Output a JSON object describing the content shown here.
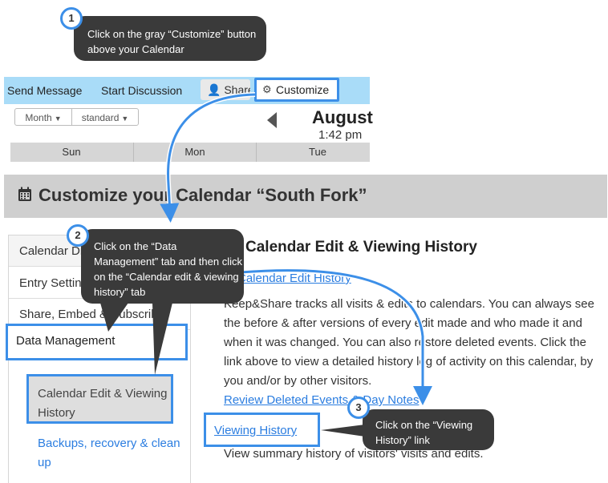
{
  "toolbar": {
    "send_message": "Send Message",
    "start_discussion": "Start Discussion",
    "share": "Share",
    "customize": "Customize"
  },
  "calendar_header": {
    "view_select": "Month",
    "style_select": "standard",
    "month": "August",
    "time": "1:42 pm",
    "days": [
      "Sun",
      "Mon",
      "Tue"
    ]
  },
  "banner": {
    "title": "Customize your Calendar “South Fork”"
  },
  "nav": {
    "items": [
      "Calendar Display",
      "Entry Settings",
      "Share, Embed & Subscribe"
    ],
    "active": "Data Management",
    "sub_selected": "Calendar Edit & Viewing History",
    "sub_link": "Backups, recovery & clean up"
  },
  "content": {
    "title": "Calendar Edit & Viewing History",
    "edit_link": "Calendar Edit History",
    "description": "Keep&Share tracks all visits & edits to calendars. You can always see the before & after versions of every edit made and who made it and when it was changed. You can also restore deleted events. Click the link above to view a detailed history log of activity on this calendar, by you and/or by other visitors.",
    "review_link": "Review Deleted Events & Day Notes",
    "viewing_link": "Viewing History",
    "viewing_summary": "View summary history of visitors' visits and edits."
  },
  "callouts": [
    {
      "number": "1",
      "text": "Click on the gray “Customize” button above your Calendar"
    },
    {
      "number": "2",
      "text": "Click on the “Data Management” tab and then click on the “Calendar edit & viewing history” tab"
    },
    {
      "number": "3",
      "text": "Click on the “Viewing History” link"
    }
  ],
  "colors": {
    "toolbar_bg": "#a9dcf8",
    "highlight": "#3c8fe8",
    "callout_bg": "#3a3a3a",
    "link": "#2b7de0",
    "banner_bg": "#cfcfcf"
  },
  "icons": {
    "customize": "gear-icon",
    "share": "person-icon",
    "banner": "calendar-icon"
  }
}
